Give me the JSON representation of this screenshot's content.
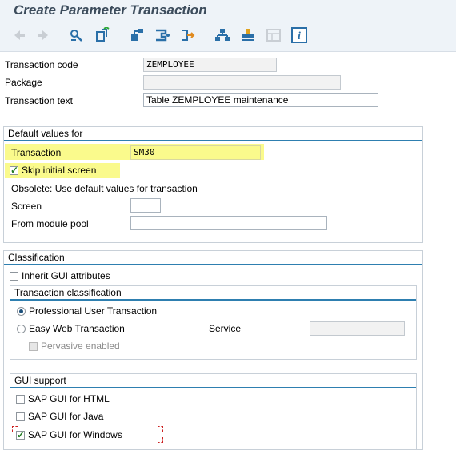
{
  "title": "Create Parameter Transaction",
  "toolbar": {
    "icons": [
      "back-arrow-icon",
      "forward-arrow-icon",
      "display-change-icon",
      "other-object-icon",
      "object-tree-icon",
      "where-used-icon",
      "navigation-icon",
      "hierarchy-icon",
      "stamp-icon",
      "table-icon",
      "info-icon"
    ]
  },
  "header": {
    "transaction_code_label": "Transaction code",
    "transaction_code_value": "ZEMPLOYEE",
    "package_label": "Package",
    "package_value": "",
    "transaction_text_label": "Transaction text",
    "transaction_text_value": "Table ZEMPLOYEE maintenance"
  },
  "defaults": {
    "group_title": "Default values for",
    "transaction_label": "Transaction",
    "transaction_value": "SM30",
    "skip_initial_label": "Skip initial screen",
    "skip_initial_checked": true,
    "obsolete_text": "Obsolete: Use default values for transaction",
    "screen_label": "Screen",
    "screen_value": "",
    "module_pool_label": "From module pool",
    "module_pool_value": ""
  },
  "classification": {
    "group_title": "Classification",
    "inherit_label": "Inherit GUI attributes",
    "inherit_checked": false,
    "tc_group_title": "Transaction classification",
    "professional_label": "Professional User Transaction",
    "professional_selected": true,
    "easy_web_label": "Easy Web Transaction",
    "service_label": "Service",
    "service_value": "",
    "pervasive_label": "Pervasive enabled"
  },
  "gui_support": {
    "group_title": "GUI support",
    "html_label": "SAP GUI for HTML",
    "java_label": "SAP GUI for Java",
    "windows_label": "SAP GUI for Windows",
    "windows_checked": true
  },
  "colors": {
    "highlight": "#fafa8c",
    "accent": "#2e7fb0",
    "check": "#1f7a1f"
  }
}
